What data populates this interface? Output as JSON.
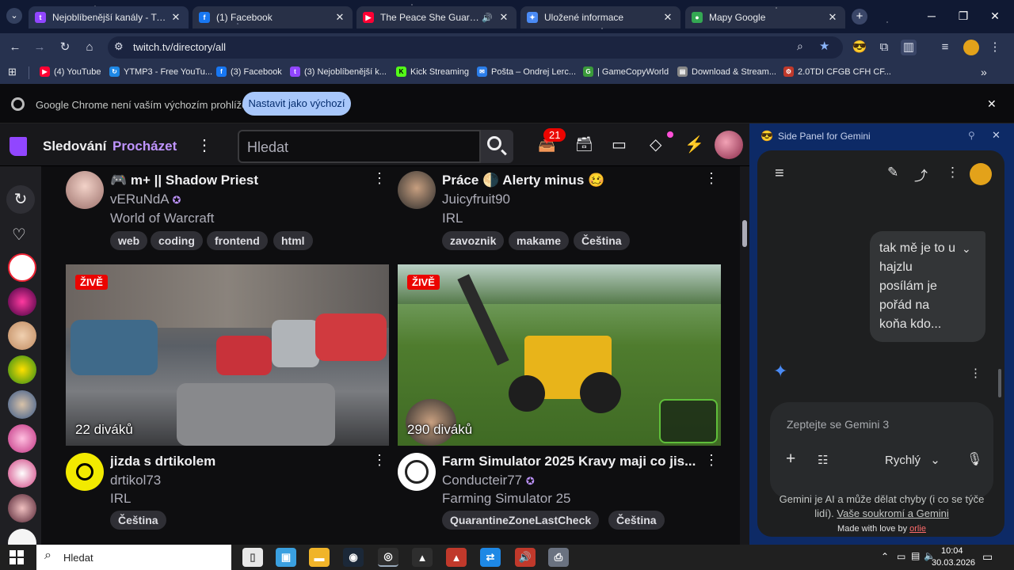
{
  "browser": {
    "tabs": [
      {
        "title": "Nejoblíbenější kanály - Twitch",
        "icon": "twitch-icon",
        "color": "#9146ff"
      },
      {
        "title": "(1) Facebook",
        "icon": "facebook-icon",
        "color": "#1877f2"
      },
      {
        "title": "The Peace She Guards | Am",
        "icon": "youtube-icon",
        "color": "#ff0033"
      },
      {
        "title": "Uložené informace",
        "icon": "gemini-icon",
        "color": "#4a8af4"
      },
      {
        "title": "Mapy Google",
        "icon": "maps-icon",
        "color": "#34a853"
      }
    ],
    "url": "twitch.tv/directory/all",
    "bookmarks": [
      {
        "label": "(4) YouTube",
        "color": "#ff0033"
      },
      {
        "label": "YTMP3 - Free YouTu...",
        "color": "#1e88e5"
      },
      {
        "label": "(3) Facebook",
        "color": "#1877f2"
      },
      {
        "label": "(3) Nejoblíbenější k...",
        "color": "#9146ff"
      },
      {
        "label": "Kick Streaming",
        "color": "#53fc18"
      },
      {
        "label": "Pošta – Ondrej Lerc...",
        "color": "#2b7de9"
      },
      {
        "label": "| GameCopyWorld",
        "color": "#3a9a3a"
      },
      {
        "label": "Download & Stream...",
        "color": "#888888"
      },
      {
        "label": "2.0TDI CFGB CFH CF...",
        "color": "#c0392b"
      }
    ],
    "infobar": {
      "message": "Google Chrome není vaším výchozím prohlížečem",
      "button": "Nastavit jako výchozí"
    }
  },
  "twitch": {
    "nav": {
      "following": "Sledování",
      "browse": "Procházet"
    },
    "search_placeholder": "Hledat",
    "notifications_count": "21",
    "accent": "#bf94ff",
    "streams": [
      {
        "title": "🎮 m+ || Shadow Priest",
        "channel": "vERuNdA",
        "verified": true,
        "category": "World of Warcraft",
        "tags": [
          "web",
          "coding",
          "frontend",
          "html"
        ]
      },
      {
        "title": "Práce 🌗 Alerty minus 🥴",
        "channel": "Juicyfruit90",
        "verified": false,
        "category": "IRL",
        "tags": [
          "zavoznik",
          "makame",
          "Čeština"
        ]
      },
      {
        "title": "jizda s drtikolem",
        "channel": "drtikol73",
        "verified": false,
        "category": "IRL",
        "tags": [
          "Čeština"
        ],
        "live_label": "ŽIVĚ",
        "viewers": "22 diváků"
      },
      {
        "title": "Farm Simulator 2025 Kravy maji co jis...",
        "channel": "Conducteir77",
        "verified": true,
        "category": "Farming Simulator 25",
        "tags": [
          "QuarantineZoneLastCheck",
          "Čeština"
        ],
        "live_label": "ŽIVĚ",
        "viewers": "290 diváků"
      }
    ]
  },
  "gemini": {
    "panel_title": "Side Panel for Gemini",
    "user_message": "tak mě je to u hajzlu posílám je pořád na koňa kdo...",
    "input_placeholder": "Zeptejte se Gemini 3",
    "mode": "Rychlý",
    "disclaimer": "Gemini je AI a může dělat chyby (i co se týče lidí).",
    "privacy_link": "Vaše soukromí a Gemini",
    "made_with": "Made with love by",
    "author": "orlie"
  },
  "taskbar": {
    "search_placeholder": "Hledat",
    "time": "10:04",
    "date": "30.03.2026"
  }
}
